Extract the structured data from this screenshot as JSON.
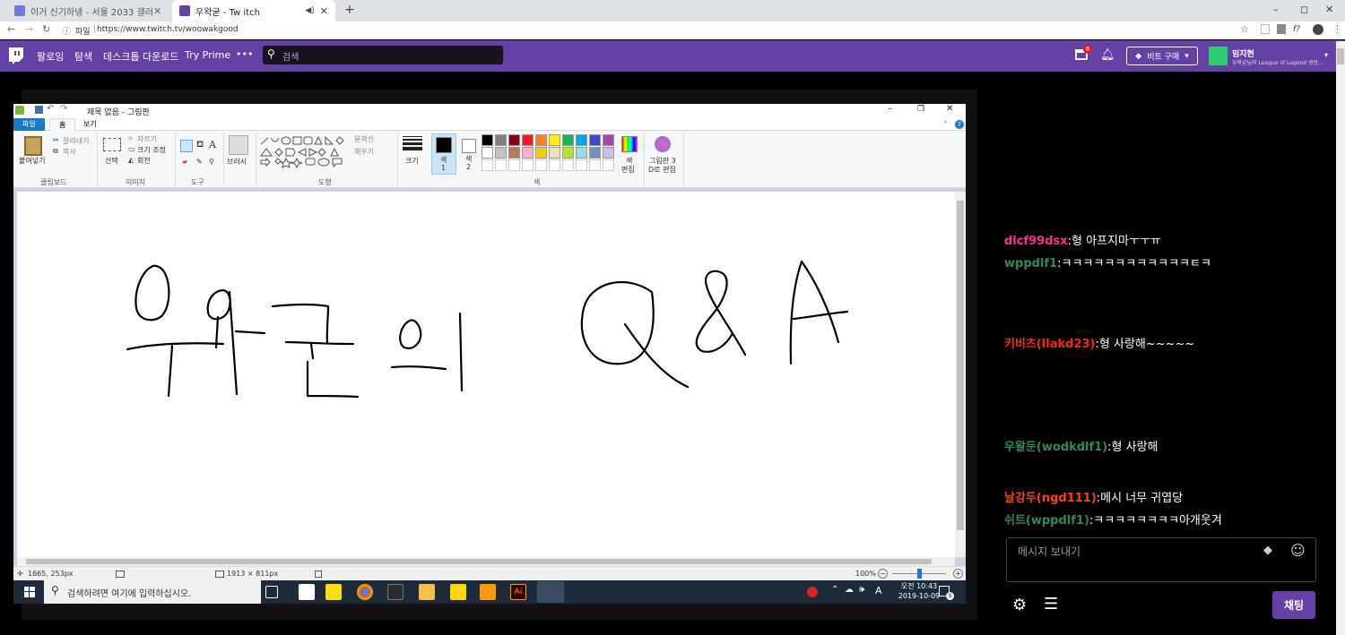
{
  "browser": {
    "tabs": [
      {
        "title": "이거 신기하넹 - 서울 2033 갤러"
      },
      {
        "title": "우왁굳 - Tw itch"
      }
    ],
    "new_tab": "+",
    "address_prefix": "파일",
    "url": "https://www.twitch.tv/woowakgood",
    "window_controls": [
      "–",
      "◻",
      "✕"
    ]
  },
  "twitch_nav": {
    "items": [
      "팔로잉",
      "탐색",
      "데스크톱 다운로드",
      "Try Prime",
      "•••"
    ],
    "search_placeholder": "검색",
    "notification_count": "8",
    "buy_bits": "비트 구매",
    "user_name": "임지현",
    "user_status": "우왁굳님의 League of Legend 생방..."
  },
  "paint": {
    "title": "제목 없음 - 그림판",
    "tabs": [
      "파일",
      "홈",
      "보기"
    ],
    "clipboard": {
      "paste": "붙여넣기",
      "cut": "잘라내기",
      "copy": "복사",
      "group": "클립보드"
    },
    "image": {
      "select": "선택",
      "crop": "자르기",
      "resize": "크기 조정",
      "rotate": "회전",
      "group": "이미지"
    },
    "tools": {
      "group": "도구",
      "brushes": "브러시"
    },
    "shapes": {
      "outline": "윤곽선",
      "fill": "채우기",
      "group": "도형"
    },
    "size": "크기",
    "color1": "색\n1",
    "color1_l1": "색",
    "color1_l2": "1",
    "color2_l1": "색",
    "color2_l2": "2",
    "edit_colors": "색\n편집",
    "edit_l1": "색",
    "edit_l2": "편집",
    "paint3d_l1": "그림판 3",
    "paint3d_l2": "D로 편집",
    "colors_group": "색",
    "palette_row1": [
      "#000000",
      "#7f7f7f",
      "#880015",
      "#ed1c24",
      "#ff7f27",
      "#fff200",
      "#22b14c",
      "#00a2e8",
      "#3f48cc",
      "#a349a4"
    ],
    "palette_row2": [
      "#ffffff",
      "#c3c3c3",
      "#b97a57",
      "#ffaec9",
      "#ffc90e",
      "#efe4b0",
      "#b5e61d",
      "#99d9ea",
      "#7092be",
      "#c8bfe7"
    ],
    "status_cursor": "1665, 253px",
    "status_size": "1913 × 811px",
    "zoom": "100%"
  },
  "taskbar": {
    "search_placeholder": "검색하려면 여기에 입력하십시오.",
    "ime": "A",
    "time_ampm": "오전 10:43",
    "date": "2019-10-09",
    "notif_badge": "5"
  },
  "chat": {
    "messages": [
      {
        "user": "dlcf99dsx",
        "color": "#ff2f8d",
        "text": "형 아프지마ㅜㅜㅠ"
      },
      {
        "user": "wppdlf1",
        "color": "#2e8b57",
        "text": "ㅋㅋㅋㅋㅋㅋㅋㅋㅋㅋㅋㅋㅌㅋ"
      },
      {
        "user": "키비츠(llakd23)",
        "color": "#ff2222",
        "text": "형 사랑해~~~~~"
      },
      {
        "user": "우왈둔(wodkdlf1)",
        "color": "#2e8b57",
        "text": "형 사랑해"
      },
      {
        "user": "날강두(ngd111)",
        "color": "#ff4500",
        "text": "메시 너무 귀엽당"
      },
      {
        "user": "쉬트(wppdlf1)",
        "color": "#2e8b57",
        "text": "ㅋㅋㅋㅋㅋㅋㅋㅋ아개웃겨"
      }
    ],
    "input_placeholder": "메시지 보내기",
    "send_label": "채팅"
  }
}
